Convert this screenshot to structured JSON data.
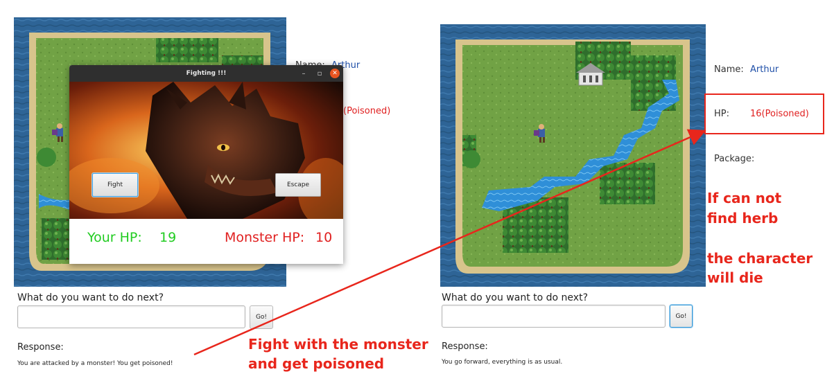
{
  "left_panel": {
    "name_label": "Name:",
    "name_value": "Arthur",
    "hp_status": "(Poisoned)",
    "prompt": "What do you want to do next?",
    "input_value": "",
    "go_label": "Go!",
    "response_title": "Response:",
    "response_text": "You are attacked by a monster! You get poisoned!"
  },
  "dialog": {
    "title": "Fighting !!!",
    "minimize_icon": "–",
    "maximize_icon": "▫",
    "close_icon": "✕",
    "fight_label": "Fight",
    "escape_label": "Escape",
    "your_hp_label": "Your HP:",
    "your_hp_value": "19",
    "monster_hp_label": "Monster HP:",
    "monster_hp_value": "10"
  },
  "right_panel": {
    "name_label": "Name:",
    "name_value": "Arthur",
    "hp_label": "HP:",
    "hp_value": "16(Poisoned)",
    "package_label": "Package:",
    "prompt": "What do you want to do next?",
    "input_value": "",
    "go_label": "Go!",
    "response_title": "Response:",
    "response_text": "You go forward, everything is as usual."
  },
  "annotations": {
    "fight_line1": "Fight with the monster",
    "fight_line2": "and get poisoned",
    "herb_line1": "If can not",
    "herb_line2": "find herb",
    "die_line1": "the character",
    "die_line2": "will die"
  },
  "colors": {
    "annotation_red": "#e8261c",
    "player_hp_green": "#22cc22",
    "monster_hp_red": "#e02020",
    "name_blue": "#1f4fa8",
    "sea": "#2d5f8a",
    "grass": "#6fa043"
  }
}
